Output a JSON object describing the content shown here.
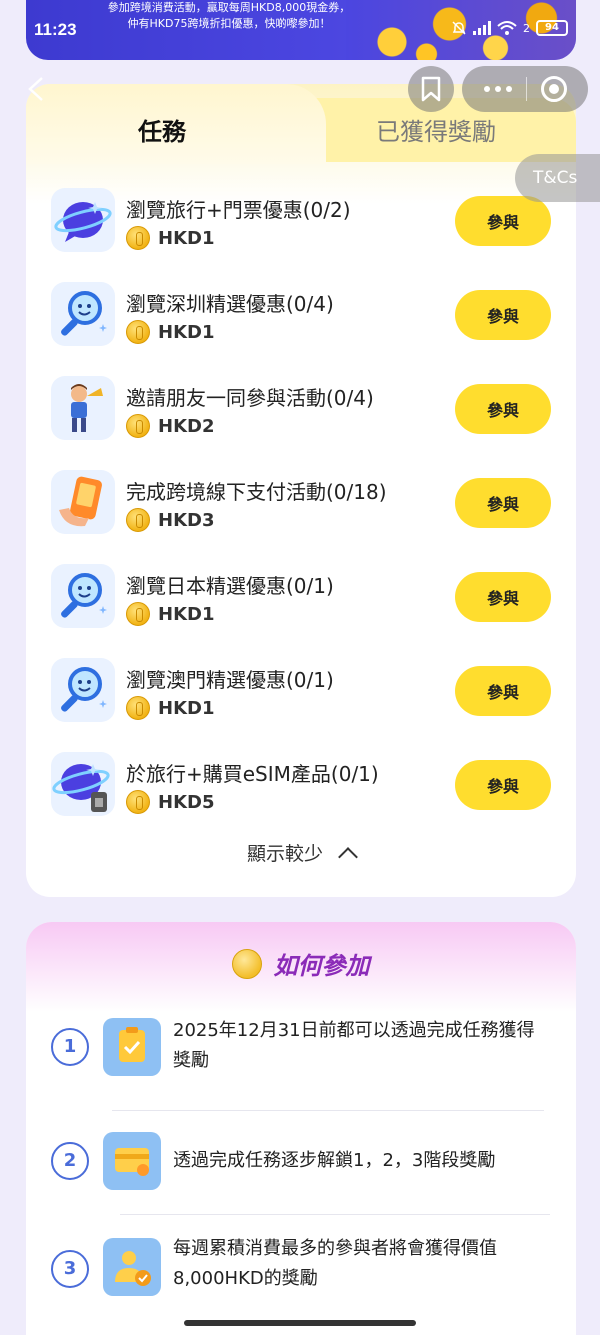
{
  "status": {
    "time": "11:23",
    "battery": "94",
    "network_label": "2"
  },
  "banner": {
    "line1": "參加跨境消費活動，贏取每周HKD8,000現金券，",
    "line2": "仲有HKD75跨境折扣優惠，快啲嚟參加！"
  },
  "floating": {
    "tcs_label": "T&Cs"
  },
  "tabs": [
    {
      "label": "任務",
      "active": true
    },
    {
      "label": "已獲得獎勵",
      "active": false
    }
  ],
  "tasks": [
    {
      "title": "瀏覽旅行+門票優惠(0/2)",
      "reward": "HKD1",
      "button": "參與",
      "icon": "planet-chat-icon"
    },
    {
      "title": "瀏覽深圳精選優惠(0/4)",
      "reward": "HKD1",
      "button": "參與",
      "icon": "magnifier-icon"
    },
    {
      "title": "邀請朋友一同參與活動(0/4)",
      "reward": "HKD2",
      "button": "參與",
      "icon": "trumpet-character-icon"
    },
    {
      "title": "完成跨境線下支付活動(0/18)",
      "reward": "HKD3",
      "button": "參與",
      "icon": "phone-hand-icon"
    },
    {
      "title": "瀏覽日本精選優惠(0/1)",
      "reward": "HKD1",
      "button": "參與",
      "icon": "magnifier-icon"
    },
    {
      "title": "瀏覽澳門精選優惠(0/1)",
      "reward": "HKD1",
      "button": "參與",
      "icon": "magnifier-icon"
    },
    {
      "title": "於旅行+購買eSIM產品(0/1)",
      "reward": "HKD5",
      "button": "參與",
      "icon": "planet-sim-icon"
    }
  ],
  "show_less": "顯示較少",
  "how_to": {
    "title": "如何參加",
    "steps": [
      {
        "num": "1",
        "text": "2025年12月31日前都可以透過完成任務獲得獎勵",
        "icon": "clipboard-check-icon"
      },
      {
        "num": "2",
        "text": "透過完成任務逐步解鎖1，2，3階段獎勵",
        "icon": "card-icon"
      },
      {
        "num": "3",
        "text": "每週累積消費最多的參與者將會獲得價值8,000HKD的獎勵",
        "icon": "user-badge-icon"
      }
    ]
  },
  "colors": {
    "accent_button": "#ffdd2e",
    "banner": "#4b46e0",
    "how_title": "#8b2bb8",
    "step_blue": "#4a6cd9"
  }
}
